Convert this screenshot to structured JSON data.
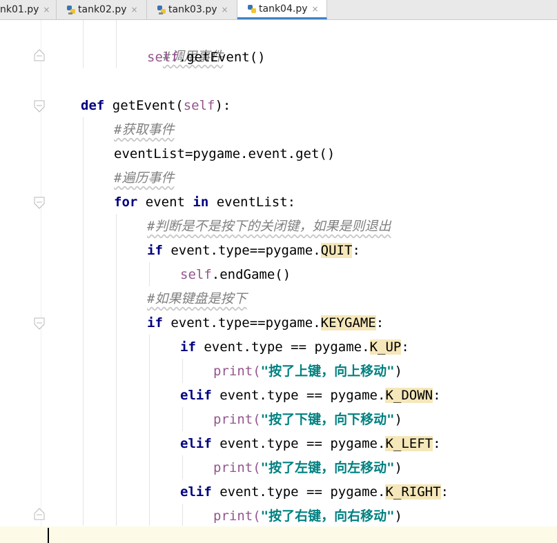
{
  "tabs": [
    {
      "label": "nk01.py",
      "active": false,
      "icon": "python-file-icon"
    },
    {
      "label": "tank02.py",
      "active": false,
      "icon": "python-file-icon"
    },
    {
      "label": "tank03.py",
      "active": false,
      "icon": "python-file-icon"
    },
    {
      "label": "tank04.py",
      "active": true,
      "icon": "python-file-icon"
    }
  ],
  "close_glyph": "×",
  "code": {
    "l1_comment": "#调用事件",
    "l2_self": "self",
    "l2_rest": ".getEvent()",
    "l4_def": "def",
    "l4_name": " getEvent(",
    "l4_self": "self",
    "l4_end": "):",
    "l5_comment": "#获取事件",
    "l6": "eventList=pygame.event.get()",
    "l7_comment": "#遍历事件",
    "l8_for": "for",
    "l8_mid": " event ",
    "l8_in": "in",
    "l8_end": " eventList:",
    "l9_comment": "#判断是不是按下的关闭键，如果是则退出",
    "l10_if": "if",
    "l10_mid": " event.type==pygame.",
    "l10_hl": "QUIT",
    "l10_end": ":",
    "l11_self": "self",
    "l11_rest": ".endGame()",
    "l12_comment": "#如果键盘是按下",
    "l13_if": "if",
    "l13_mid": " event.type==pygame.",
    "l13_hl": "KEYGAME",
    "l13_end": ":",
    "l14_if": "if",
    "l14_mid": " event.type == pygame.",
    "l14_hl": "K_UP",
    "l14_end": ":",
    "l15_print": "print(",
    "l15_str": "\"按了上键，向上移动\"",
    "l15_end": ")",
    "l16_elif": "elif",
    "l16_mid": " event.type == pygame.",
    "l16_hl": "K_DOWN",
    "l16_end": ":",
    "l17_print": "print(",
    "l17_str": "\"按了下键，向下移动\"",
    "l17_end": ")",
    "l18_elif": "elif",
    "l18_mid": " event.type == pygame.",
    "l18_hl": "K_LEFT",
    "l18_end": ":",
    "l19_print": "print(",
    "l19_str": "\"按了左键，向左移动\"",
    "l19_end": ")",
    "l20_elif": "elif",
    "l20_mid": " event.type == pygame.",
    "l20_hl": "K_RIGHT",
    "l20_end": ":",
    "l21_print": "print(",
    "l21_str": "\"按了右键，向右移动\"",
    "l21_end": ")"
  },
  "colors": {
    "keyword": "#000080",
    "self": "#94558d",
    "comment": "#808080",
    "string": "#008080",
    "highlight": "#f5e7ba",
    "active_tab_underline": "#4083c9"
  }
}
